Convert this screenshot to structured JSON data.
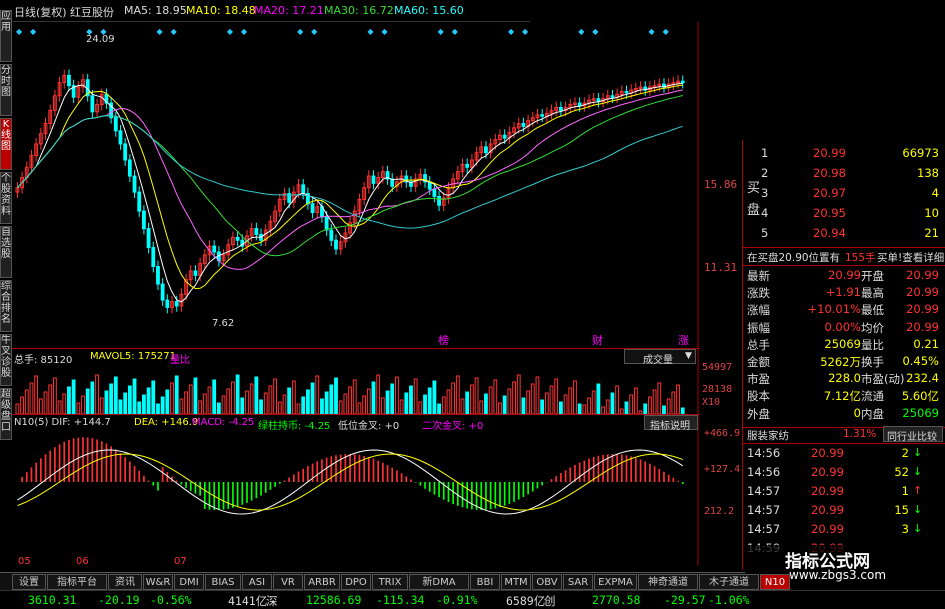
{
  "chart_header": {
    "title": "日线(复权)",
    "stock_name": "红豆股份",
    "ma5": "MA5: 18.95",
    "ma10": "MA10: 18.48",
    "ma20": "MA20: 17.21",
    "ma30": "MA30: 16.72",
    "ma60": "MA60: 15.60"
  },
  "colors": {
    "ma5": "#ffffff",
    "ma10": "#ffff00",
    "ma20": "#ff66ff",
    "ma30": "#33dd33",
    "ma60": "#33cccc",
    "up": "#ff3232",
    "down": "#00ffff",
    "price_axis": "#dd3333"
  },
  "left_tabs": [
    "应用",
    "分时图",
    "K线图",
    "个股资料",
    "自选股",
    "综合排名",
    "牛叉诊股",
    "超级盘口"
  ],
  "main_chart": {
    "high_label": "24.09",
    "low_label": "7.62",
    "y_ticks": [
      "15.86",
      "11.31"
    ],
    "x_markers": [
      "榜",
      "财",
      "涨"
    ],
    "chart_data": {
      "type": "line",
      "x": [
        0,
        1,
        2,
        3,
        4,
        5,
        6,
        7,
        8,
        9,
        10,
        11,
        12,
        13,
        14,
        15,
        16,
        17,
        18,
        19,
        20,
        21,
        22,
        23,
        24,
        25,
        26,
        27,
        28,
        29,
        30,
        31,
        32,
        33,
        34,
        35,
        36,
        37,
        38,
        39,
        40,
        41,
        42,
        43,
        44,
        45,
        46,
        47,
        48,
        49,
        50,
        51,
        52,
        53,
        54,
        55,
        56,
        57,
        58,
        59,
        60,
        61,
        62,
        63,
        64,
        65,
        66,
        67,
        68,
        69,
        70,
        71,
        72,
        73,
        74,
        75,
        76,
        77,
        78,
        79,
        80,
        81,
        82,
        83,
        84,
        85,
        86,
        87,
        88,
        89,
        90,
        91,
        92,
        93,
        94,
        95,
        96,
        97,
        98,
        99,
        100,
        101,
        102,
        103,
        104,
        105,
        106,
        107,
        108,
        109,
        110,
        111,
        112,
        113,
        114,
        115,
        116,
        117,
        118,
        119,
        120,
        121,
        122,
        123,
        124,
        125,
        126,
        127,
        128,
        129,
        130,
        131,
        132,
        133,
        134,
        135,
        136,
        137,
        138,
        139,
        140,
        141,
        142
      ],
      "close": [
        16.2,
        16.9,
        17.6,
        18.4,
        19.2,
        19.9,
        20.6,
        21.5,
        22.5,
        23.4,
        23.9,
        23.2,
        22.4,
        23.1,
        23.6,
        22.5,
        21.4,
        21.9,
        22.6,
        22.0,
        21.0,
        20.1,
        19.2,
        18.1,
        17.0,
        15.9,
        14.6,
        13.4,
        12.1,
        10.8,
        9.6,
        8.5,
        8.0,
        8.4,
        8.1,
        8.9,
        9.9,
        10.5,
        10.2,
        11.0,
        11.6,
        12.2,
        11.8,
        11.2,
        11.6,
        12.3,
        12.8,
        12.6,
        12.2,
        12.9,
        13.4,
        13.0,
        12.6,
        13.3,
        13.9,
        14.6,
        15.4,
        15.8,
        15.2,
        15.9,
        16.4,
        15.8,
        15.1,
        14.5,
        14.9,
        14.2,
        13.3,
        12.6,
        12.0,
        12.5,
        13.1,
        13.8,
        14.6,
        15.4,
        16.2,
        17.0,
        16.5,
        16.9,
        17.3,
        16.8,
        16.3,
        16.6,
        17.0,
        16.6,
        16.3,
        16.8,
        17.1,
        16.6,
        16.1,
        15.6,
        15.0,
        15.5,
        16.2,
        16.8,
        17.3,
        17.8,
        17.6,
        18.1,
        18.6,
        19.0,
        18.6,
        19.2,
        19.5,
        19.8,
        19.6,
        20.0,
        20.3,
        20.6,
        20.4,
        20.8,
        21.0,
        21.2,
        21.1,
        21.3,
        21.5,
        21.7,
        21.5,
        21.7,
        21.9,
        22.0,
        21.8,
        22.0,
        22.2,
        22.3,
        22.1,
        22.3,
        22.5,
        22.4,
        22.6,
        22.8,
        22.7,
        22.9,
        23.0,
        23.1,
        22.9,
        23.1,
        23.2,
        23.3,
        23.1,
        23.3,
        23.4,
        23.5,
        23.4
      ],
      "price_range": [
        7.0,
        25.5
      ]
    }
  },
  "volume_panel": {
    "label": "总手: 85120",
    "mavol": "MAVOL5: 175271",
    "extra": "量比",
    "dropdown": "成交量",
    "y_ticks": [
      "54997",
      "28138",
      "X10"
    ]
  },
  "macd_panel": {
    "dif": "N10(5) DIF: +144.7",
    "dea": "DEA: +146.9",
    "macd": "MACD: -4.25",
    "green_label": "绿柱持币: -4.25",
    "low_gold": "低位金叉: +0",
    "second_gold": "二次金叉: +0",
    "button": "指标说明",
    "y_ticks": [
      "+466.9",
      "+127.4",
      "212.2"
    ],
    "month_labels": [
      "05",
      "06",
      "07"
    ]
  },
  "order_book": {
    "side_label_buy": "买盘",
    "rows": [
      {
        "n": "1",
        "price": "20.99",
        "vol": "66973"
      },
      {
        "n": "2",
        "price": "20.98",
        "vol": "138"
      },
      {
        "n": "3",
        "price": "20.97",
        "vol": "4"
      },
      {
        "n": "4",
        "price": "20.95",
        "vol": "10"
      },
      {
        "n": "5",
        "price": "20.94",
        "vol": "21"
      }
    ],
    "summary_left": "在买盘20.90位置有",
    "summary_mid": "155手",
    "summary_right": "买单!查看详细"
  },
  "stats": [
    {
      "l1": "最新",
      "v1": "20.99",
      "l2": "开盘",
      "v2": "20.99"
    },
    {
      "l1": "涨跌",
      "v1": "+1.91",
      "l2": "最高",
      "v2": "20.99"
    },
    {
      "l1": "涨幅",
      "v1": "+10.01%",
      "l2": "最低",
      "v2": "20.99"
    },
    {
      "l1": "振幅",
      "v1": "0.00%",
      "l2": "均价",
      "v2": "20.99"
    },
    {
      "l1": "总手",
      "v1": "25069",
      "l2": "量比",
      "v2": "0.21"
    },
    {
      "l1": "金额",
      "v1": "5262万",
      "l2": "换手",
      "v2": "0.45%"
    },
    {
      "l1": "市盈",
      "v1": "228.0",
      "l2": "市盈(动)",
      "v2": "232.4"
    },
    {
      "l1": "股本",
      "v1": "7.12亿",
      "l2": "流通",
      "v2": "5.60亿"
    },
    {
      "l1": "外盘",
      "v1": "0",
      "l2": "内盘",
      "v2": "25069"
    }
  ],
  "industry": {
    "name": "服装家纺",
    "pct": "1.31%",
    "button": "同行业比较"
  },
  "ticks": [
    {
      "t": "14:56",
      "p": "20.99",
      "v": "2"
    },
    {
      "t": "14:56",
      "p": "20.99",
      "v": "52"
    },
    {
      "t": "14:57",
      "p": "20.99",
      "v": "1"
    },
    {
      "t": "14:57",
      "p": "20.99",
      "v": "15"
    },
    {
      "t": "14:57",
      "p": "20.99",
      "v": "3"
    },
    {
      "t": "14:59",
      "p": "20.99",
      "v": ""
    }
  ],
  "bottom_tabs": [
    "设置",
    "指标平台",
    "资讯",
    "W&R",
    "DMI",
    "BIAS",
    "ASI",
    "VR",
    "ARBR",
    "DPO",
    "TRIX",
    "新DMA",
    "BBI",
    "MTM",
    "OBV",
    "SAR",
    "EXPMA",
    "神奇通道",
    "木子通道",
    "N10"
  ],
  "status_bar": {
    "sh_index": "3610.31",
    "sh_chg": "-20.19",
    "sh_pct": "-0.56%",
    "sh_amt": "4141亿",
    "sz_label": "深",
    "sz_index": "12586.69",
    "sz_chg": "-115.34",
    "sz_pct": "-0.91%",
    "sz_amt": "6589亿",
    "cy_label": "创",
    "cy_index": "2770.58",
    "cy_chg": "-29.57",
    "cy_pct": "-1.06%"
  },
  "watermark": {
    "line1": "指标公式网",
    "line2": "www.zbgs3.com"
  }
}
